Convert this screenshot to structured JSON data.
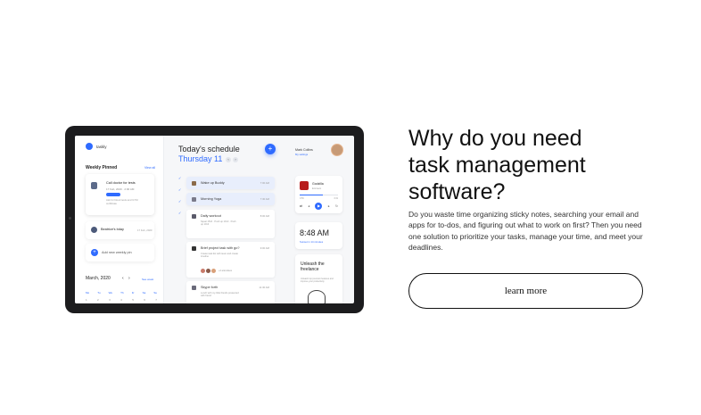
{
  "app": {
    "logo_text": "taskly",
    "weekly_pinned": {
      "title": "Weekly Pinned",
      "view_all": "View all",
      "card1": {
        "title": "Call doctor for tests",
        "date": "17 Feb, 2020 · 2:00 AM",
        "note": "Ask for blood tests and GYM certificate"
      },
      "card2": {
        "title": "Beatrice's bday",
        "date": "17 Feb, 2020"
      },
      "card3": {
        "title": "Add new weekly pin"
      }
    },
    "calendar": {
      "month": "March, 2020",
      "nav": "‹ ›",
      "link": "See week",
      "days": [
        "Mo",
        "Tu",
        "We",
        "Th",
        "Fr",
        "Sa",
        "Su"
      ],
      "nums": [
        "1",
        "2",
        "3",
        "4",
        "5",
        "6",
        "7"
      ]
    },
    "schedule": {
      "title": "Today's schedule",
      "date": "Thursday 11",
      "nav_prev": "‹",
      "nav_next": "›",
      "add": "+",
      "tasks": [
        {
          "title": "Wake up Buddy",
          "time": "7:00 AM"
        },
        {
          "title": "Morning Yoga",
          "time": "7:30 AM"
        },
        {
          "title": "Daily workout",
          "time": "8:00 AM",
          "sub": "Squat 15x3 · Push up 10x3 · Push up 10x3"
        },
        {
          "title": "Brief project task with go?",
          "time": "9:00 AM",
          "sub": "Create task list with team and create timeline",
          "extra": "+2 attendees"
        },
        {
          "title": "Skype forth",
          "time": "11:30 AM",
          "sub": "Lunch with my little friends presented with friend"
        }
      ]
    },
    "user": {
      "name": "Mark Collins",
      "sub": "My settings"
    },
    "music": {
      "song": "Godzilla",
      "artist": "Eminem",
      "start": "0:56",
      "end": "3:31",
      "progress": 0.6
    },
    "clock": {
      "time": "8:48 AM",
      "weather": "Sunset in 14 minutes"
    },
    "promo": {
      "title": "Unleash the freelance",
      "sub": "Unleash top premium features and improve your productivity"
    }
  },
  "content": {
    "heading_line1": "Why do you need",
    "heading_line2": "task management",
    "heading_line3": "software?",
    "description": "Do you waste time organizing sticky notes, searching your email and apps for to-dos, and figuring out what to work on first? Then you need one solution to prioritize your tasks, manage your time, and meet your deadlines.",
    "cta_label": "learn more"
  }
}
